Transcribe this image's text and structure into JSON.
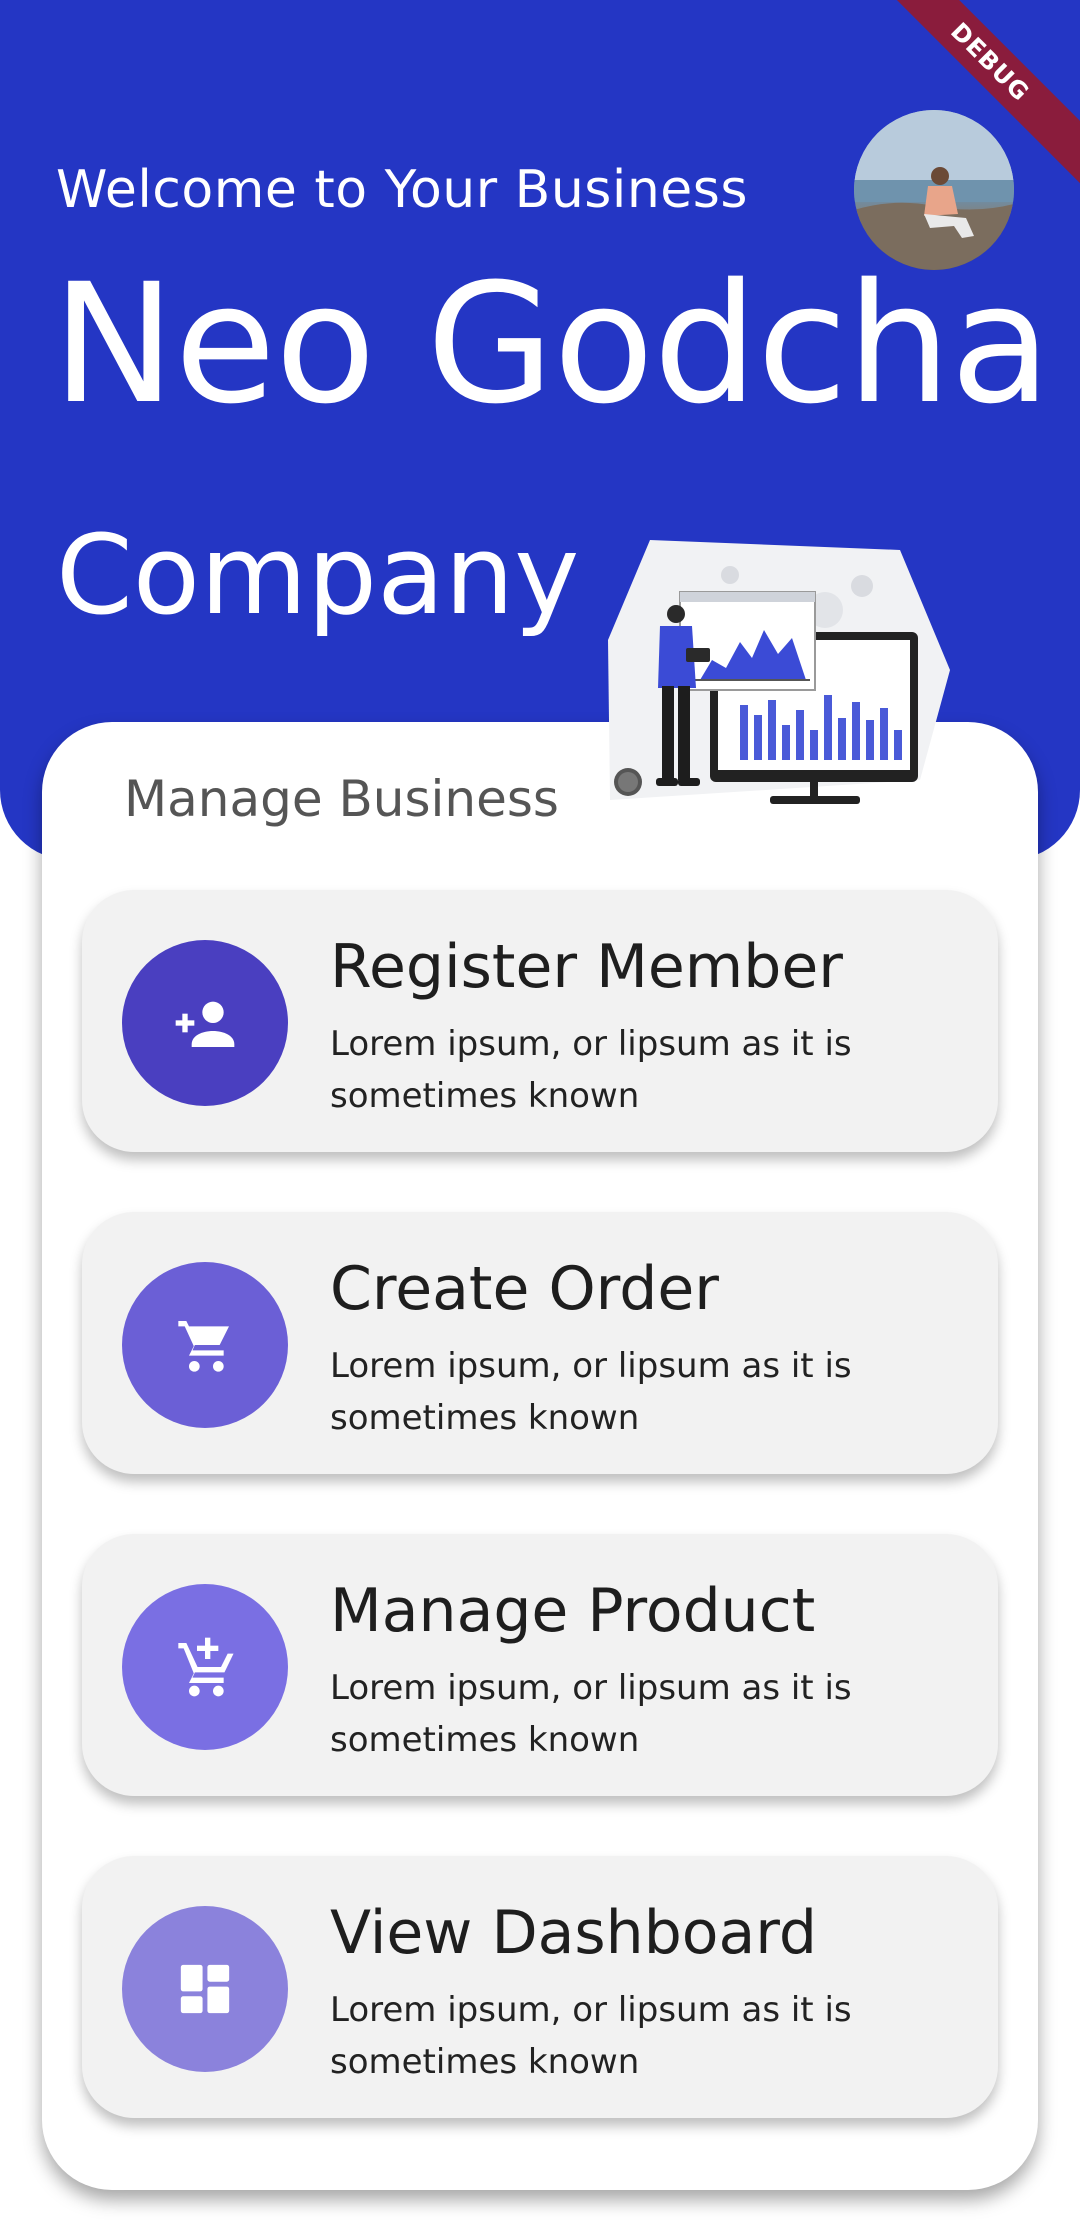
{
  "header": {
    "welcome": "Welcome to Your Business",
    "company_name_line1": "Neo Godcha",
    "company_name_line2": "Company",
    "background_color": "#2436c4"
  },
  "debug_banner": "DEBUG",
  "card": {
    "title": "Manage Business",
    "items": [
      {
        "title": "Register Member",
        "description": "Lorem ipsum, or lipsum as it is sometimes known",
        "icon": "person-add-icon",
        "color": "#4a3fc0"
      },
      {
        "title": "Create Order",
        "description": "Lorem ipsum, or lipsum as it is sometimes known",
        "icon": "shopping-cart-icon",
        "color": "#6b5fd6"
      },
      {
        "title": "Manage Product",
        "description": "Lorem ipsum, or lipsum as it is sometimes known",
        "icon": "add-shopping-cart-icon",
        "color": "#7a6fe3"
      },
      {
        "title": "View Dashboard",
        "description": "Lorem ipsum, or lipsum as it is sometimes known",
        "icon": "dashboard-icon",
        "color": "#8b82dc"
      }
    ]
  }
}
